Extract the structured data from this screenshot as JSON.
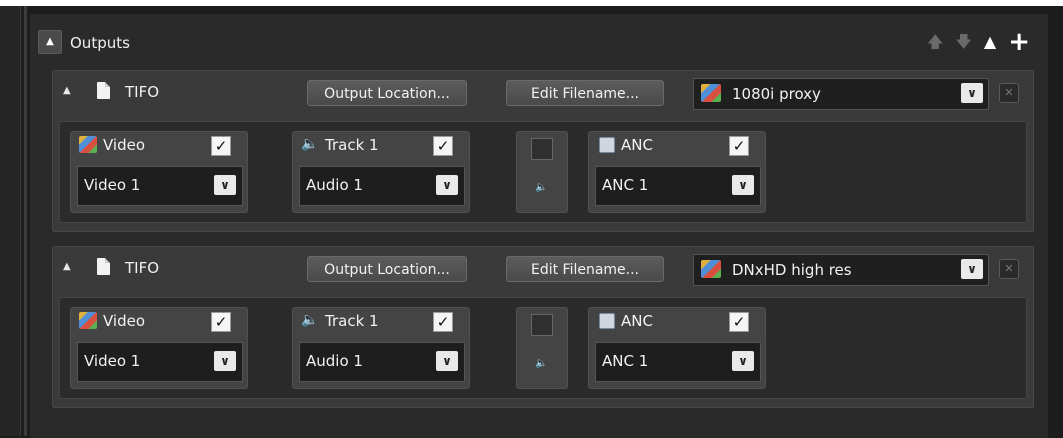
{
  "panel": {
    "title": "Outputs",
    "actions": {
      "move_up_icon": "arrow-up-icon",
      "move_down_icon": "arrow-down-icon",
      "collapse_all_icon": "triangle-up-icon",
      "add_label": "+"
    }
  },
  "outputs": [
    {
      "format": "TIFO",
      "output_location_label": "Output Location...",
      "edit_filename_label": "Edit Filename...",
      "preset": "1080i proxy",
      "tracks": [
        {
          "label": "Video",
          "checked": true,
          "selected": "Video 1",
          "icon": "video-icon"
        },
        {
          "label": "Track 1",
          "checked": true,
          "selected": "Audio 1",
          "icon": "audio-icon"
        },
        {
          "label": "ANC",
          "checked": true,
          "selected": "ANC 1",
          "icon": "anc-icon"
        }
      ],
      "extra_track_checked": false
    },
    {
      "format": "TIFO",
      "output_location_label": "Output Location...",
      "edit_filename_label": "Edit Filename...",
      "preset": "DNxHD high res",
      "tracks": [
        {
          "label": "Video",
          "checked": true,
          "selected": "Video 1",
          "icon": "video-icon"
        },
        {
          "label": "Track 1",
          "checked": true,
          "selected": "Audio 1",
          "icon": "audio-icon"
        },
        {
          "label": "ANC",
          "checked": true,
          "selected": "ANC 1",
          "icon": "anc-icon"
        }
      ],
      "extra_track_checked": false
    }
  ],
  "colors": {
    "background": "#1d1d1d",
    "panel": "#2a2a2a",
    "block": "#3a3a3a",
    "accent_text": "#f2f2f2"
  }
}
